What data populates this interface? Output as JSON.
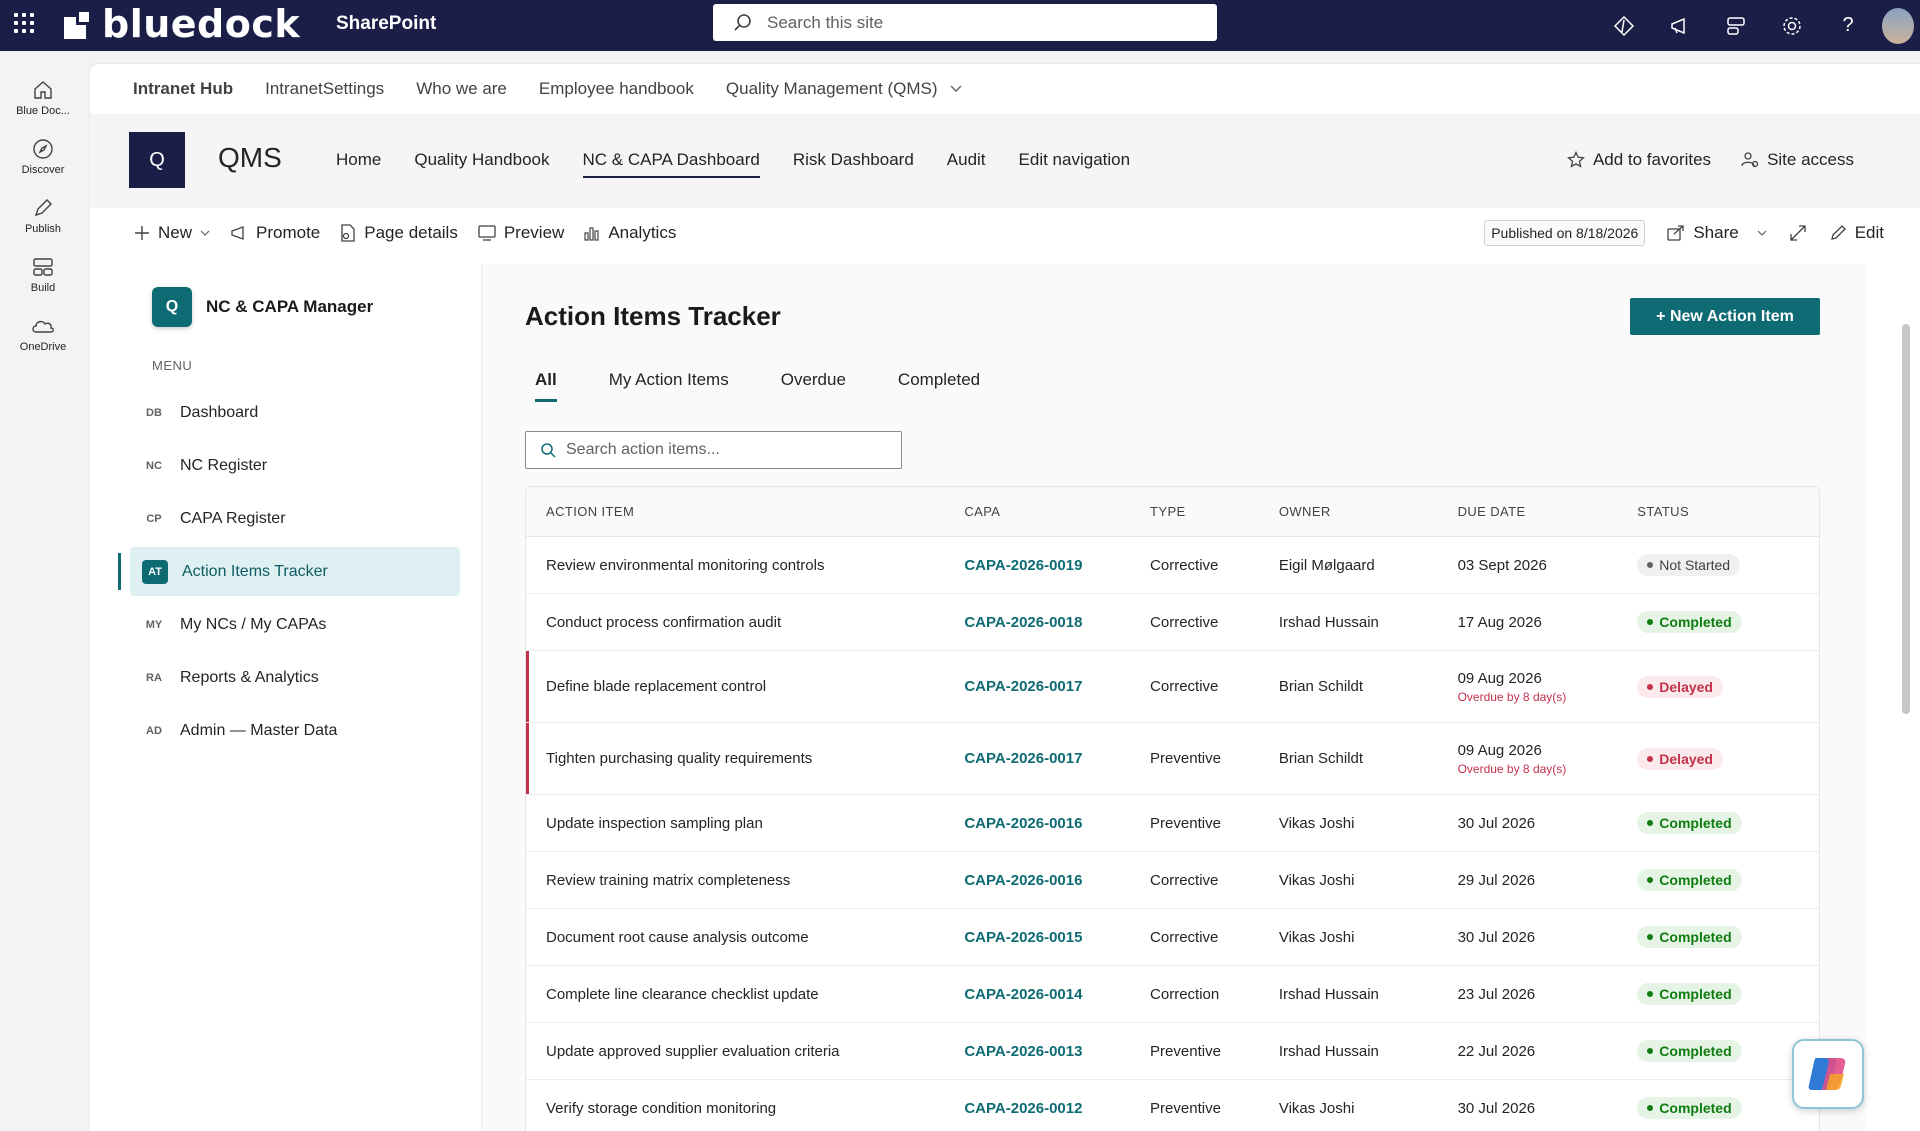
{
  "suite": {
    "brand": "bluedock",
    "app": "SharePoint",
    "search_placeholder": "Search this site"
  },
  "appbar": [
    {
      "label": "Blue Doc...",
      "icon": "home-icon"
    },
    {
      "label": "Discover",
      "icon": "compass-icon"
    },
    {
      "label": "Publish",
      "icon": "pen-icon"
    },
    {
      "label": "Build",
      "icon": "layout-icon"
    },
    {
      "label": "OneDrive",
      "icon": "cloud-icon"
    }
  ],
  "hubnav": {
    "title": "Intranet Hub",
    "items": [
      "IntranetSettings",
      "Who we are",
      "Employee handbook",
      "Quality Management (QMS)"
    ]
  },
  "site": {
    "logo_letter": "Q",
    "name": "QMS",
    "nav": [
      "Home",
      "Quality Handbook",
      "NC & CAPA Dashboard",
      "Risk Dashboard",
      "Audit",
      "Edit navigation"
    ],
    "add_favorites": "Add to favorites",
    "site_access": "Site access"
  },
  "commandbar": {
    "new": "New",
    "promote": "Promote",
    "page_details": "Page details",
    "preview": "Preview",
    "analytics": "Analytics",
    "published": "Published on 8/18/2026",
    "share": "Share",
    "edit": "Edit"
  },
  "leftnav": {
    "app_badge": "Q",
    "app_name": "NC & CAPA Manager",
    "menu_label": "MENU",
    "items": [
      {
        "code": "DB",
        "label": "Dashboard"
      },
      {
        "code": "NC",
        "label": "NC Register"
      },
      {
        "code": "CP",
        "label": "CAPA Register"
      },
      {
        "code": "AT",
        "label": "Action Items Tracker"
      },
      {
        "code": "MY",
        "label": "My NCs / My CAPAs"
      },
      {
        "code": "RA",
        "label": "Reports & Analytics"
      },
      {
        "code": "AD",
        "label": "Admin — Master Data"
      }
    ]
  },
  "tracker": {
    "title": "Action Items Tracker",
    "new_button": "+ New Action Item",
    "tabs": [
      "All",
      "My Action Items",
      "Overdue",
      "Completed"
    ],
    "search_placeholder": "Search action items...",
    "columns": [
      "ACTION ITEM",
      "CAPA",
      "TYPE",
      "OWNER",
      "DUE DATE",
      "STATUS"
    ],
    "rows": [
      {
        "item": "Review environmental monitoring controls",
        "capa": "CAPA-2026-0019",
        "type": "Corrective",
        "owner": "Eigil Mølgaard",
        "due": "03 Sept 2026",
        "overdue": "",
        "status": "Not Started",
        "status_kind": "ns"
      },
      {
        "item": "Conduct process confirmation audit",
        "capa": "CAPA-2026-0018",
        "type": "Corrective",
        "owner": "Irshad Hussain",
        "due": "17 Aug 2026",
        "overdue": "",
        "status": "Completed",
        "status_kind": "c"
      },
      {
        "item": "Define blade replacement control",
        "capa": "CAPA-2026-0017",
        "type": "Corrective",
        "owner": "Brian Schildt",
        "due": "09 Aug 2026",
        "overdue": "Overdue by 8 day(s)",
        "status": "Delayed",
        "status_kind": "d"
      },
      {
        "item": "Tighten purchasing quality requirements",
        "capa": "CAPA-2026-0017",
        "type": "Preventive",
        "owner": "Brian Schildt",
        "due": "09 Aug 2026",
        "overdue": "Overdue by 8 day(s)",
        "status": "Delayed",
        "status_kind": "d"
      },
      {
        "item": "Update inspection sampling plan",
        "capa": "CAPA-2026-0016",
        "type": "Preventive",
        "owner": "Vikas Joshi",
        "due": "30 Jul 2026",
        "overdue": "",
        "status": "Completed",
        "status_kind": "c"
      },
      {
        "item": "Review training matrix completeness",
        "capa": "CAPA-2026-0016",
        "type": "Corrective",
        "owner": "Vikas Joshi",
        "due": "29 Jul 2026",
        "overdue": "",
        "status": "Completed",
        "status_kind": "c"
      },
      {
        "item": "Document root cause analysis outcome",
        "capa": "CAPA-2026-0015",
        "type": "Corrective",
        "owner": "Vikas Joshi",
        "due": "30 Jul 2026",
        "overdue": "",
        "status": "Completed",
        "status_kind": "c"
      },
      {
        "item": "Complete line clearance checklist update",
        "capa": "CAPA-2026-0014",
        "type": "Correction",
        "owner": "Irshad Hussain",
        "due": "23 Jul 2026",
        "overdue": "",
        "status": "Completed",
        "status_kind": "c"
      },
      {
        "item": "Update approved supplier evaluation criteria",
        "capa": "CAPA-2026-0013",
        "type": "Preventive",
        "owner": "Irshad Hussain",
        "due": "22 Jul 2026",
        "overdue": "",
        "status": "Completed",
        "status_kind": "c"
      },
      {
        "item": "Verify storage condition monitoring",
        "capa": "CAPA-2026-0012",
        "type": "Preventive",
        "owner": "Vikas Joshi",
        "due": "30 Jul 2026",
        "overdue": "",
        "status": "Completed",
        "status_kind": "c"
      }
    ]
  },
  "colors": {
    "suitebar": "#1b1f48",
    "accent": "#0e6b73",
    "completed": "#107c10",
    "delayed": "#c4314b"
  }
}
